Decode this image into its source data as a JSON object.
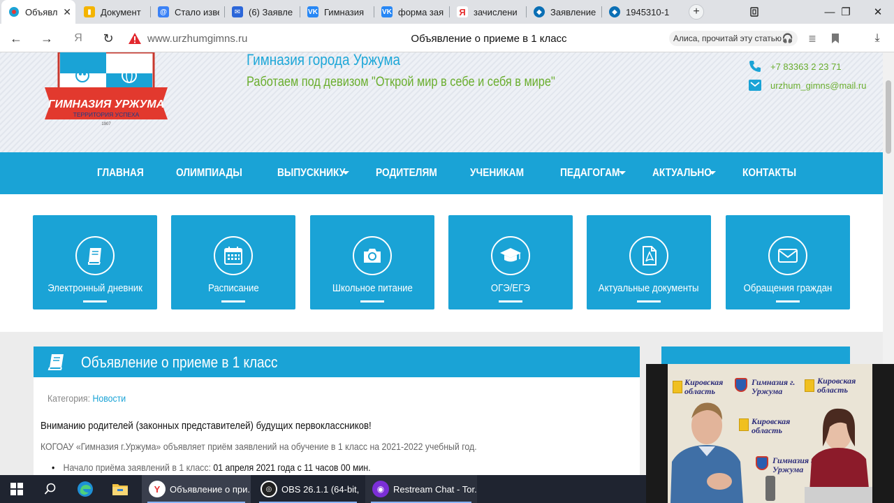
{
  "browser": {
    "tabs": [
      {
        "label": "Объявл",
        "icon": "gimn-favicon",
        "color": "#ffffff",
        "close": "✕",
        "active": true
      },
      {
        "label": "Документ",
        "icon": "doc-favicon",
        "color": "#f4b400"
      },
      {
        "label": "Стало изве",
        "icon": "at-favicon",
        "color": "#3b82f6"
      },
      {
        "label": "(6) Заявле",
        "icon": "mail-favicon",
        "color": "#2b66d9"
      },
      {
        "label": "Гимназия",
        "icon": "vk-favicon",
        "color": "#2787f5"
      },
      {
        "label": "форма зая",
        "icon": "vk-favicon",
        "color": "#2787f5"
      },
      {
        "label": "зачислени",
        "icon": "yandex-favicon",
        "color": "#e62e2e"
      },
      {
        "label": "Заявление",
        "icon": "gosuslugi-favicon",
        "color": "#0a6fb5"
      },
      {
        "label": "1945310-1",
        "icon": "gosuslugi-favicon",
        "color": "#0a6fb5"
      }
    ],
    "new_tab_symbol": "+",
    "window_controls": {
      "minimize": "—",
      "maximize": "❐",
      "close": "✕"
    },
    "nav": {
      "back": "←",
      "forward": "→",
      "yandex": "Я",
      "reload": "↻"
    },
    "url": "www.urzhumgimns.ru",
    "page_title": "Объявление о приеме в 1 класс",
    "alice_label": "Алиса, прочитай эту статью",
    "alice_icon": "headphones-icon"
  },
  "site": {
    "logo": {
      "banner_text": "ГИМНАЗИЯ УРЖУМА",
      "subtitle": "ТЕРРИТОРИЯ УСПЕХА",
      "year": "1907"
    },
    "name": "Гимназия города Уржума",
    "motto": "Работаем под девизом \"Открой мир в себе и себя в мире\"",
    "contacts": [
      {
        "icon": "phone-icon",
        "text": "+7 83363 2 23 71"
      },
      {
        "icon": "email-icon",
        "text": "urzhum_gimns@mail.ru"
      }
    ],
    "nav": [
      {
        "label": "ГЛАВНАЯ",
        "dropdown": false
      },
      {
        "label": "ОЛИМПИАДЫ",
        "dropdown": false
      },
      {
        "label": "ВЫПУСКНИКУ",
        "dropdown": true
      },
      {
        "label": "РОДИТЕЛЯМ",
        "dropdown": false
      },
      {
        "label": "УЧЕНИКАМ",
        "dropdown": false
      },
      {
        "label": "ПЕДАГОГАМ",
        "dropdown": true
      },
      {
        "label": "АКТУАЛЬНО",
        "dropdown": true
      },
      {
        "label": "КОНТАКТЫ",
        "dropdown": false
      }
    ],
    "tiles": [
      {
        "label": "Электронный дневник",
        "icon": "book-icon"
      },
      {
        "label": "Расписание",
        "icon": "calendar-icon"
      },
      {
        "label": "Школьное питание",
        "icon": "camera-icon"
      },
      {
        "label": "ОГЭ/ЕГЭ",
        "icon": "graduation-cap-icon"
      },
      {
        "label": "Актуальные документы",
        "icon": "pdf-document-icon"
      },
      {
        "label": "Обращения граждан",
        "icon": "envelope-icon"
      }
    ],
    "article": {
      "title": "Объявление о приеме в 1 класс",
      "category_label": "Категория:",
      "category_link": "Новости",
      "paragraph1": "Вниманию родителей (законных представителей) будущих первоклассников!",
      "paragraph2": "КОГОАУ «Гимназия г.Уржума» объявляет приём заявлений на обучение в 1 класс на 2021-2022 учебный год.",
      "list_item_label": "Начало приёма заявлений в 1 класс:",
      "list_item_value": "01 апреля 2021 года с 11 часов 00 мин."
    }
  },
  "webcam": {
    "backdrop_texts": [
      "Кировская область",
      "Гимназия г. Уржума",
      "Кировская область",
      "Кировская область",
      "Гимназия г. Уржума"
    ]
  },
  "taskbar": {
    "pinned": [
      {
        "icon": "windows-start-icon"
      },
      {
        "icon": "search-icon"
      },
      {
        "icon": "edge-icon"
      },
      {
        "icon": "file-explorer-icon"
      }
    ],
    "apps": [
      {
        "label": "Объявление о при...",
        "icon": "yandex-browser-icon",
        "active": true
      },
      {
        "label": "OBS 26.1.1 (64-bit, ...",
        "icon": "obs-icon",
        "active": false
      },
      {
        "label": "Restream Chat - Tor...",
        "icon": "restream-icon",
        "active": false
      }
    ]
  },
  "colors": {
    "brand_blue": "#1aa3d6",
    "motto_green": "#6aae2e",
    "taskbar": "#1f2430"
  }
}
